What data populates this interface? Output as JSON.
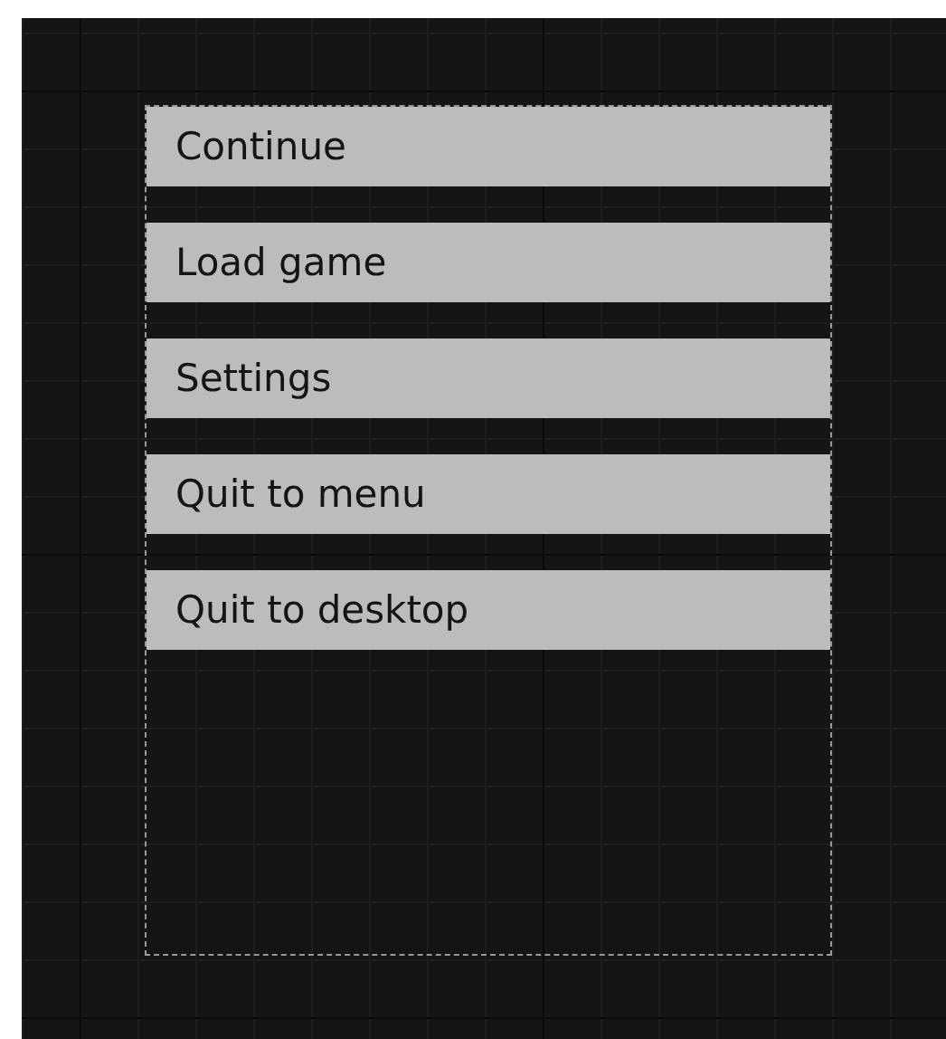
{
  "menu": {
    "buttons": [
      {
        "label": "Continue"
      },
      {
        "label": "Load game"
      },
      {
        "label": "Settings"
      },
      {
        "label": "Quit to menu"
      },
      {
        "label": "Quit to desktop"
      }
    ]
  }
}
